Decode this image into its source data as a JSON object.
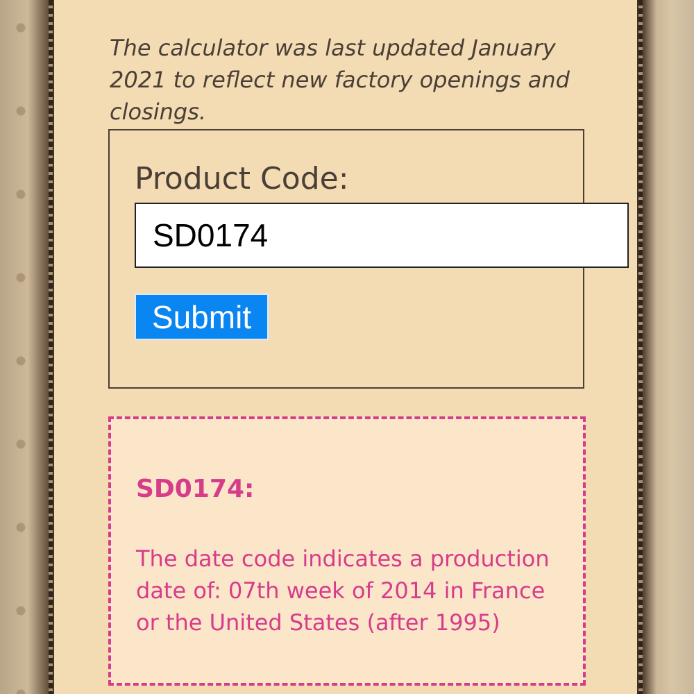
{
  "intro": {
    "text": "The calculator was last updated January 2021 to reflect new factory openings and closings."
  },
  "form": {
    "label": "Product Code:",
    "input_value": "SD0174",
    "submit_label": "Submit"
  },
  "result": {
    "title": "SD0174:",
    "text": "The date code indicates a production date of: 07th week of 2014 in France or the United States (after 1995)"
  },
  "colors": {
    "page_background": "#f3dcb3",
    "accent_pink": "#d63c8a",
    "button_blue": "#0a86f2",
    "text_dark": "#4a3f37"
  }
}
